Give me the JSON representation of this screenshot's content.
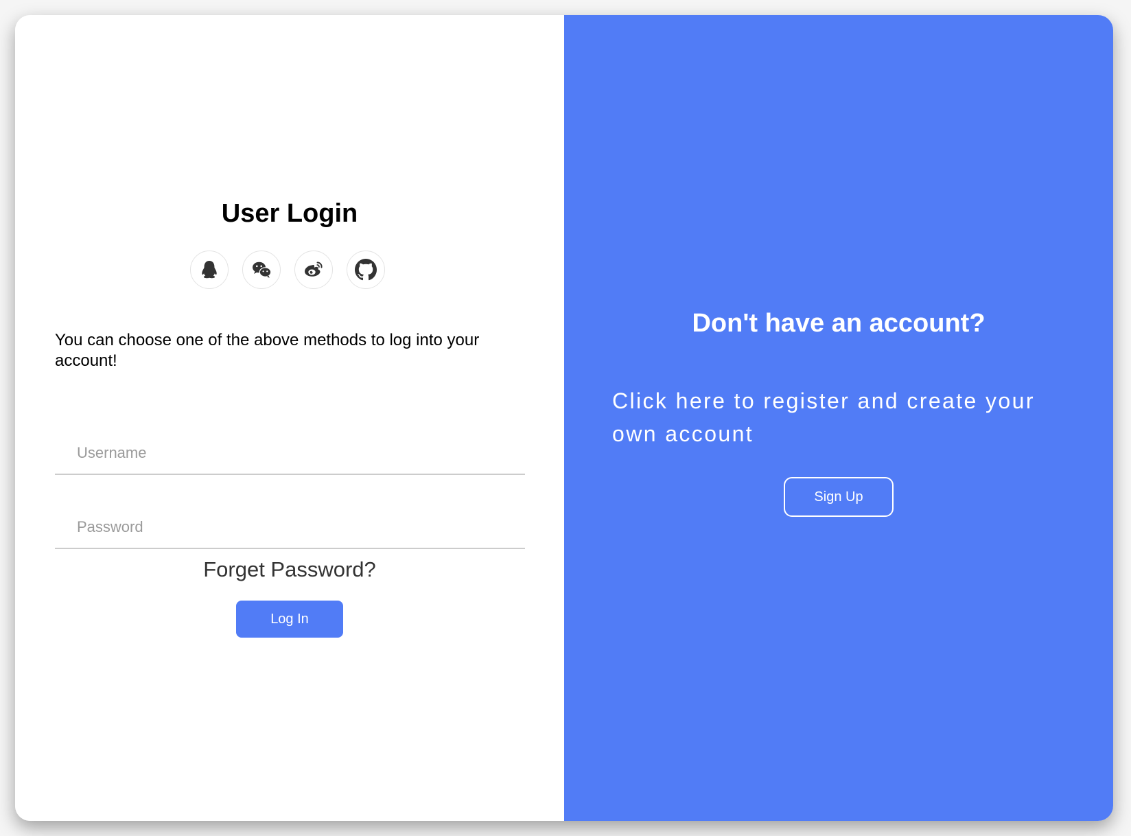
{
  "colors": {
    "accent": "#517cf6",
    "icon": "#333333",
    "divider": "#cccccc",
    "placeholder": "#9a9a9a"
  },
  "login": {
    "title": "User Login",
    "social_icons": [
      "qq-icon",
      "wechat-icon",
      "weibo-icon",
      "github-icon"
    ],
    "hint": "You can choose one of the above methods to log into your account!",
    "username": {
      "placeholder": "Username",
      "value": ""
    },
    "password": {
      "placeholder": "Password",
      "value": ""
    },
    "forget_label": "Forget Password?",
    "login_label": "Log In"
  },
  "register": {
    "title": "Don't have an account?",
    "text": "Click here to register and create your own account",
    "signup_label": "Sign Up"
  }
}
